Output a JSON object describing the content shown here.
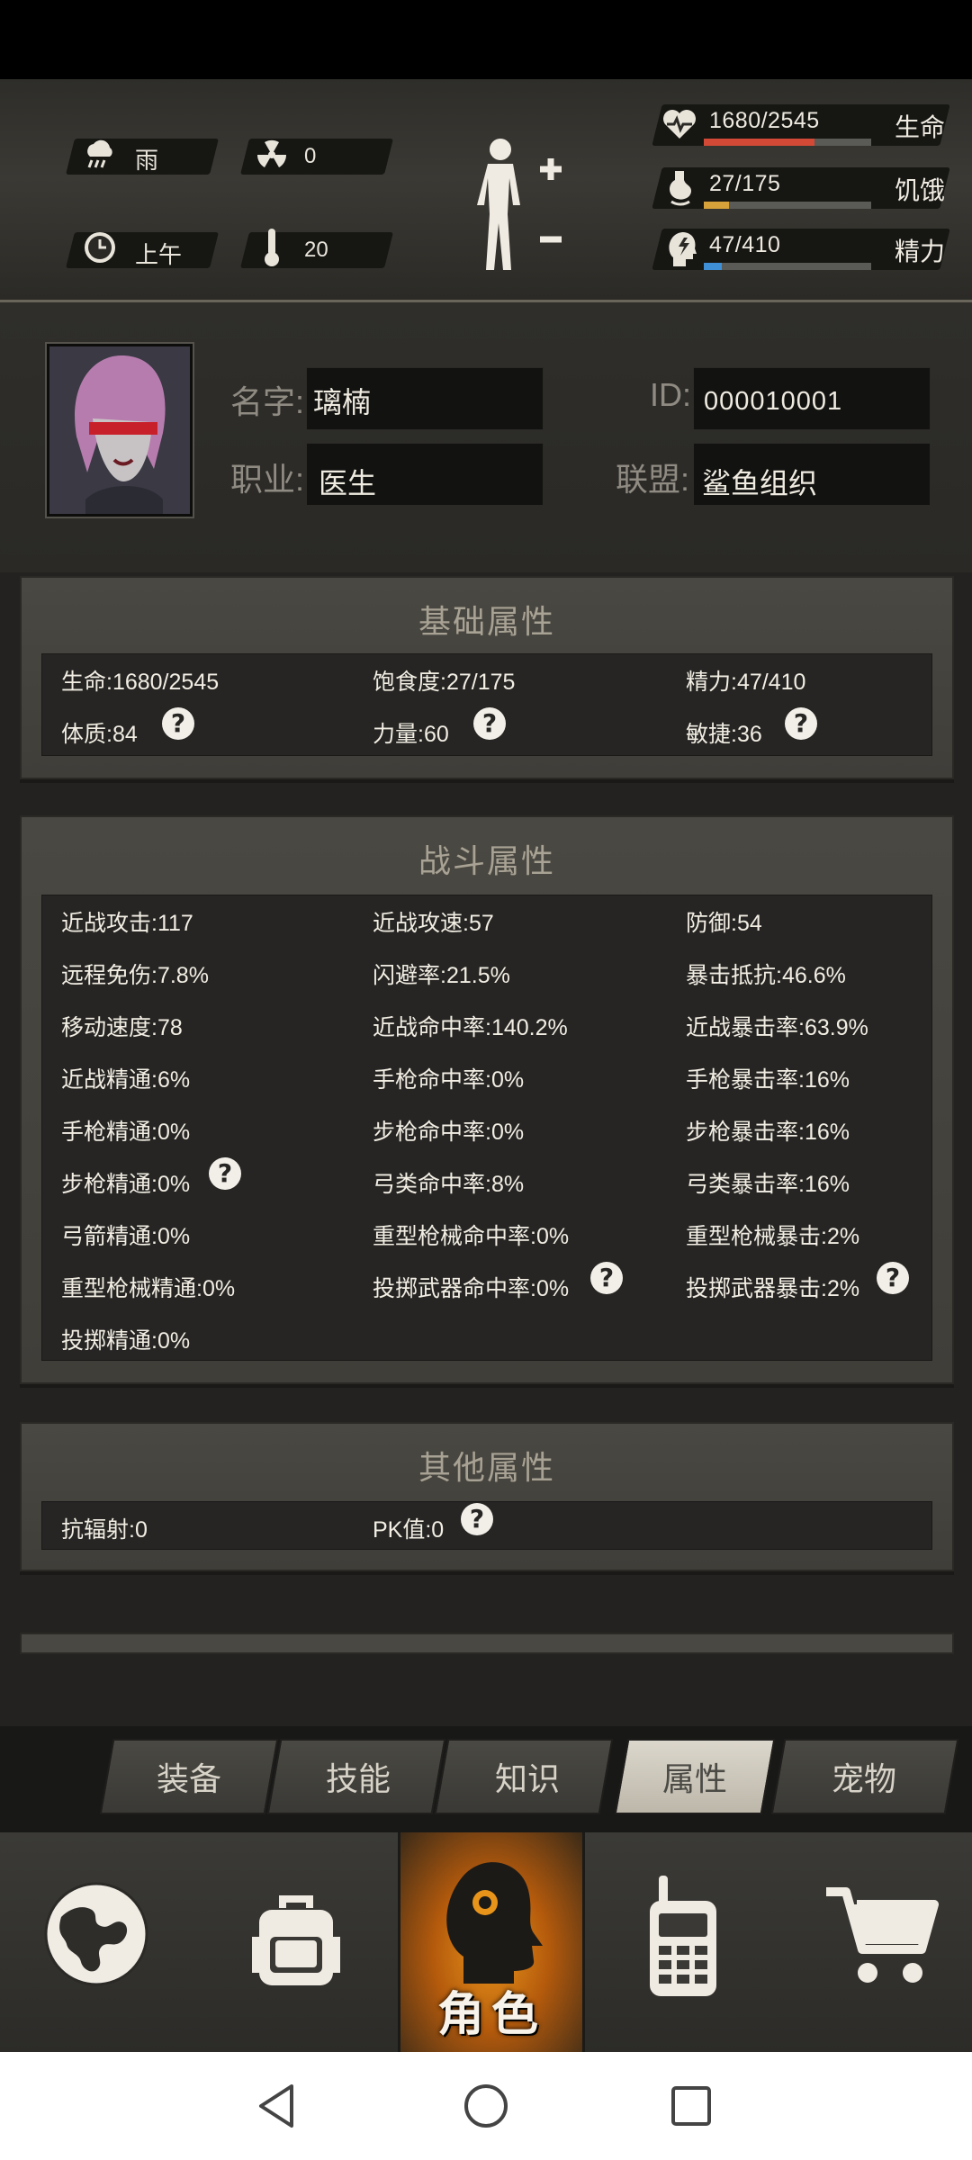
{
  "hud": {
    "weather": "雨",
    "radiation": "0",
    "time_of_day": "上午",
    "temperature": "20",
    "vitals": [
      {
        "label": "生命",
        "value": "1680/2545",
        "fraction": 0.66,
        "color": "#d24a36",
        "icon": "heart-pulse-icon"
      },
      {
        "label": "饥饿",
        "value": "27/175",
        "fraction": 0.15,
        "color": "#d7a23a",
        "icon": "stomach-icon"
      },
      {
        "label": "精力",
        "value": "47/410",
        "fraction": 0.11,
        "color": "#3f8fd6",
        "icon": "energy-head-icon"
      }
    ]
  },
  "profile": {
    "name_label": "名字:",
    "name": "璃楠",
    "id_label": "ID:",
    "id": "000010001",
    "job_label": "职业:",
    "job": "医生",
    "alliance_label": "联盟:",
    "alliance": "鲨鱼组织"
  },
  "sections": {
    "basic": {
      "title": "基础属性",
      "stats": [
        "生命:1680/2545",
        "饱食度:27/175",
        "精力:47/410",
        "体质:84",
        "力量:60",
        "敏捷:36"
      ]
    },
    "combat": {
      "title": "战斗属性",
      "stats": [
        "近战攻击:117",
        "近战攻速:57",
        "防御:54",
        "远程免伤:7.8%",
        "闪避率:21.5%",
        "暴击抵抗:46.6%",
        "移动速度:78",
        "近战命中率:140.2%",
        "近战暴击率:63.9%",
        "近战精通:6%",
        "手枪命中率:0%",
        "手枪暴击率:16%",
        "手枪精通:0%",
        "步枪命中率:0%",
        "步枪暴击率:16%",
        "步枪精通:0%",
        "弓类命中率:8%",
        "弓类暴击率:16%",
        "弓箭精通:0%",
        "重型枪械命中率:0%",
        "重型枪械暴击:2%",
        "重型枪械精通:0%",
        "投掷武器命中率:0%",
        "投掷武器暴击:2%",
        "投掷精通:0%"
      ]
    },
    "other": {
      "title": "其他属性",
      "stats": [
        "抗辐射:0",
        "PK值:0"
      ]
    }
  },
  "tabs": [
    "装备",
    "技能",
    "知识",
    "属性",
    "宠物"
  ],
  "active_tab": "属性",
  "bottom_nav": {
    "items": [
      "globe-icon",
      "backpack-icon",
      "character-icon",
      "walkie-talkie-icon",
      "shopping-cart-icon"
    ],
    "active_label": "角色"
  }
}
